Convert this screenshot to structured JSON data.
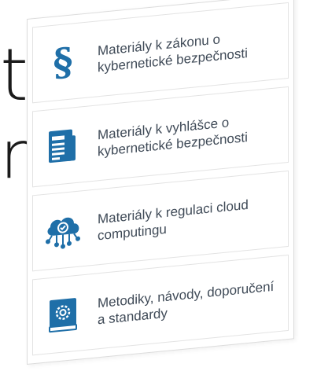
{
  "background": {
    "text_fragment_1": "t",
    "text_fragment_2": "m"
  },
  "colors": {
    "icon_blue": "#1f6fa8",
    "label_text": "#3f4a57",
    "border": "#e3e3e3"
  },
  "menu": {
    "items": [
      {
        "icon": "paragraph-icon",
        "label": "Materiály k zákonu o kybernetické bezpečnosti"
      },
      {
        "icon": "document-icon",
        "label": "Materiály k vyhlášce o kybernetické bezpečnosti"
      },
      {
        "icon": "cloud-network-icon",
        "label": "Materiály k regulaci cloud computingu"
      },
      {
        "icon": "gear-book-icon",
        "label": "Metodiky, návody, doporučení a standardy"
      }
    ]
  }
}
